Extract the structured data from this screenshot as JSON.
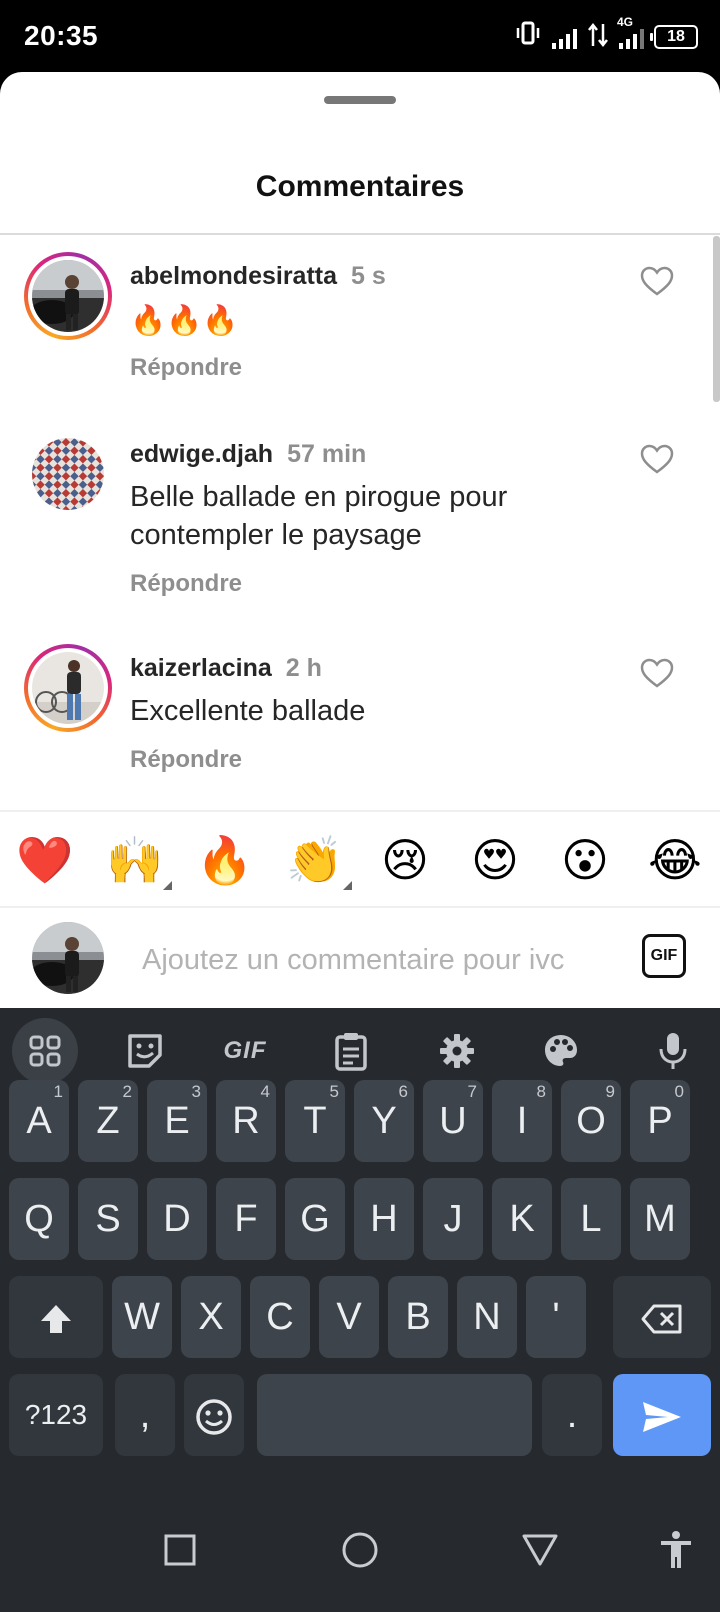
{
  "status_bar": {
    "time": "20:35",
    "network": "4G",
    "battery": "18"
  },
  "sheet": {
    "title": "Commentaires"
  },
  "comments": [
    {
      "username": "abelmondesiratta",
      "time": "5 s",
      "text": "🔥🔥🔥",
      "reply_label": "Répondre",
      "story_ring": true
    },
    {
      "username": "edwige.djah",
      "time": "57 min",
      "text": "Belle ballade en pirogue pour contempler le paysage",
      "reply_label": "Répondre",
      "story_ring": false
    },
    {
      "username": "kaizerlacina",
      "time": "2 h",
      "text": "Excellente ballade",
      "reply_label": "Répondre",
      "story_ring": true
    }
  ],
  "quick_reactions": [
    "❤️",
    "🙌",
    "🔥",
    "👏",
    "😢",
    "😍",
    "😮",
    "😂"
  ],
  "comment_input": {
    "placeholder": "Ajoutez un commentaire pour ivc",
    "gif_label": "GIF"
  },
  "keyboard": {
    "toolbar": [
      "apps-grid-icon",
      "sticker-icon",
      "gif",
      "clipboard-icon",
      "settings-gear-icon",
      "palette-icon",
      "microphone-icon"
    ],
    "toolbar_gif_label": "GIF",
    "row1": [
      {
        "k": "A",
        "h": "1"
      },
      {
        "k": "Z",
        "h": "2"
      },
      {
        "k": "E",
        "h": "3"
      },
      {
        "k": "R",
        "h": "4"
      },
      {
        "k": "T",
        "h": "5"
      },
      {
        "k": "Y",
        "h": "6"
      },
      {
        "k": "U",
        "h": "7"
      },
      {
        "k": "I",
        "h": "8"
      },
      {
        "k": "O",
        "h": "9"
      },
      {
        "k": "P",
        "h": "0"
      }
    ],
    "row2": [
      "Q",
      "S",
      "D",
      "F",
      "G",
      "H",
      "J",
      "K",
      "L",
      "M"
    ],
    "row3": [
      "W",
      "X",
      "C",
      "V",
      "B",
      "N",
      "'"
    ],
    "symbols_label": "?123",
    "comma": ",",
    "period": "."
  },
  "colors": {
    "accent_send": "#5e97f6",
    "keyboard_bg": "#262a2f",
    "key_bg": "#3e444b"
  }
}
